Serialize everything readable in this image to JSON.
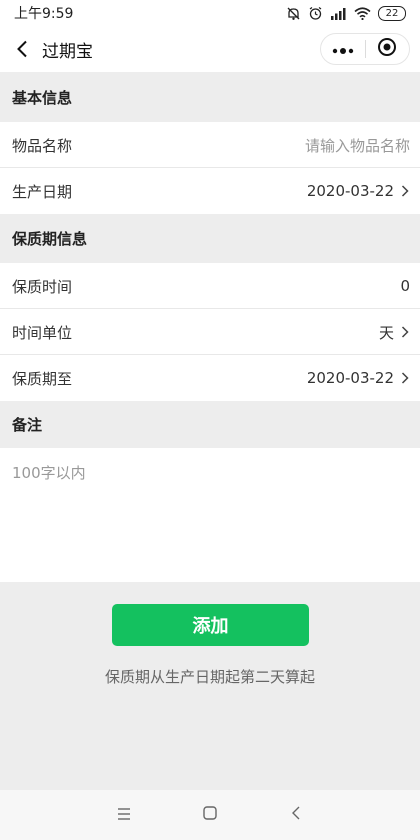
{
  "status_bar": {
    "time": "上午9:59",
    "battery": "22"
  },
  "nav": {
    "title": "过期宝"
  },
  "sections": {
    "basic": "基本信息",
    "shelf_life": "保质期信息",
    "remark": "备注"
  },
  "fields": {
    "item_name": {
      "label": "物品名称",
      "placeholder": "请输入物品名称"
    },
    "production_date": {
      "label": "生产日期",
      "value": "2020-03-22"
    },
    "shelf_time": {
      "label": "保质时间",
      "value": "0"
    },
    "time_unit": {
      "label": "时间单位",
      "value": "天"
    },
    "expiry_date": {
      "label": "保质期至",
      "value": "2020-03-22"
    },
    "remark": {
      "placeholder": "100字以内"
    }
  },
  "actions": {
    "add_label": "添加"
  },
  "hint": "保质期从生产日期起第二天算起",
  "colors": {
    "accent": "#14c15f",
    "background": "#ededed"
  },
  "icons": [
    "mute-icon",
    "alarm-icon",
    "signal-icon",
    "wifi-icon",
    "battery-icon",
    "back-arrow-icon",
    "more-icon",
    "close-target-icon",
    "chevron-right-icon",
    "menu-icon",
    "home-icon",
    "back-nav-icon"
  ]
}
